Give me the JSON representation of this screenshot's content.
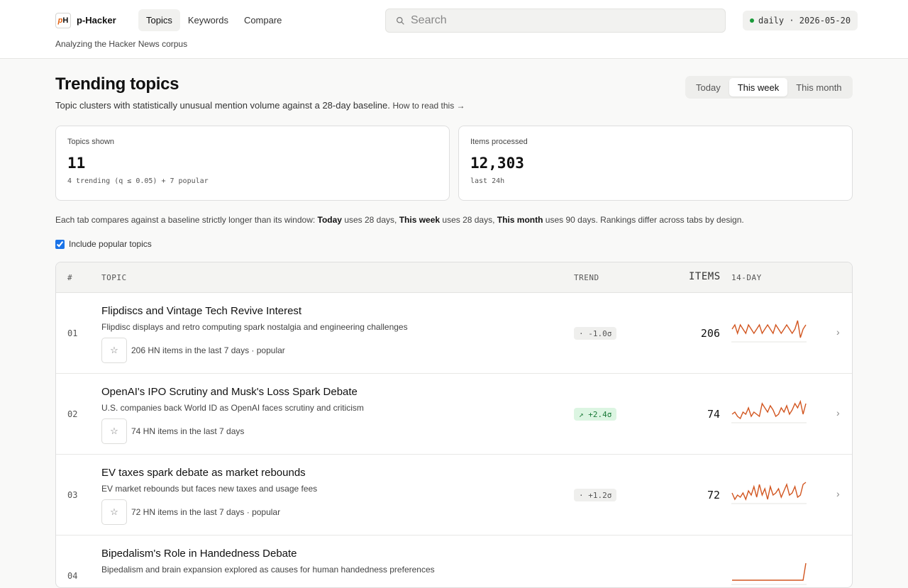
{
  "brand": {
    "logo": "pH",
    "name_prefix": "p-",
    "name": "Hacker",
    "tagline": "Analyzing the Hacker News corpus"
  },
  "nav": [
    {
      "label": "Topics",
      "active": true
    },
    {
      "label": "Keywords",
      "active": false
    },
    {
      "label": "Compare",
      "active": false
    }
  ],
  "search": {
    "placeholder": "Search"
  },
  "status": {
    "text": "daily · 2026-05-20",
    "dot_color": "#1a9a3a"
  },
  "page": {
    "title": "Trending topics",
    "subtitle": "Topic clusters with statistically unusual mention volume against a 28-day baseline.",
    "help_link": "How to read this →"
  },
  "range_tabs": [
    {
      "label": "Today",
      "active": false
    },
    {
      "label": "This week",
      "active": true
    },
    {
      "label": "This month",
      "active": false
    }
  ],
  "stats": [
    {
      "label": "Topics shown",
      "value": "11",
      "sub": "4 trending (q ≤ 0.05) + 7 popular"
    },
    {
      "label": "Items processed",
      "value": "12,303",
      "sub": "last 24h"
    }
  ],
  "note": {
    "lead": "Each tab compares against a baseline strictly longer than its window: ",
    "today_b": "Today",
    "today_t": " uses 28 days, ",
    "week_b": "This week",
    "week_t": " uses 28 days, ",
    "month_b": "This month",
    "month_t": " uses 90 days. Rankings differ across tabs by design."
  },
  "filter": {
    "label": "Include popular topics",
    "checked": true
  },
  "table": {
    "headers": {
      "num": "#",
      "topic": "TOPIC",
      "trend": "TREND",
      "items": "ITEMS",
      "spark": "14-DAY"
    },
    "rows": [
      {
        "num": "01",
        "title": "Flipdiscs and Vintage Tech Revive Interest",
        "desc": "Flipdisc displays and retro computing spark nostalgia and engineering challenges",
        "meta": "206 HN items in the last 7 days  · popular",
        "trend": "· -1.0σ",
        "trend_kind": "neutral",
        "items": "206",
        "spark": [
          6,
          7,
          5,
          7,
          6,
          5,
          7,
          6,
          5,
          6,
          7,
          5,
          6,
          7,
          6,
          5,
          7,
          6,
          5,
          6,
          7,
          6,
          5,
          6,
          8,
          4,
          6,
          7
        ]
      },
      {
        "num": "02",
        "title": "OpenAI's IPO Scrutiny and Musk's Loss Spark Debate",
        "desc": "U.S. companies back World ID as OpenAI faces scrutiny and criticism",
        "meta": "74 HN items in the last 7 days",
        "trend": "↗ +2.4σ",
        "trend_kind": "up",
        "items": "74",
        "spark": [
          3,
          4,
          2,
          1,
          4,
          3,
          6,
          2,
          4,
          3,
          2,
          8,
          6,
          4,
          7,
          5,
          2,
          3,
          6,
          4,
          7,
          3,
          5,
          8,
          6,
          9,
          3,
          8
        ]
      },
      {
        "num": "03",
        "title": "EV taxes spark debate as market rebounds",
        "desc": "EV market rebounds but faces new taxes and usage fees",
        "meta": "72 HN items in the last 7 days  · popular",
        "trend": "· +1.2σ",
        "trend_kind": "neutral",
        "items": "72",
        "spark": [
          4,
          1,
          3,
          2,
          4,
          1,
          5,
          3,
          7,
          2,
          8,
          3,
          6,
          1,
          7,
          3,
          4,
          6,
          2,
          5,
          8,
          3,
          4,
          7,
          2,
          3,
          8,
          9
        ]
      },
      {
        "num": "04",
        "title": "Bipedalism's Role in Handedness Debate",
        "desc": "Bipedalism and brain expansion explored as causes for human handedness preferences",
        "meta": "",
        "trend": "",
        "trend_kind": "neutral",
        "items": "",
        "spark": [
          1,
          1,
          1,
          1,
          1,
          1,
          1,
          1,
          1,
          1,
          1,
          1,
          1,
          1,
          1,
          1,
          1,
          1,
          1,
          1,
          1,
          1,
          1,
          1,
          1,
          1,
          1,
          9
        ]
      }
    ]
  },
  "colors": {
    "spark": "#d2551f",
    "accent": "#1a73e8"
  },
  "icons": {
    "search": "search-icon",
    "star": "star-icon",
    "chevron": "chevron-right-icon"
  }
}
